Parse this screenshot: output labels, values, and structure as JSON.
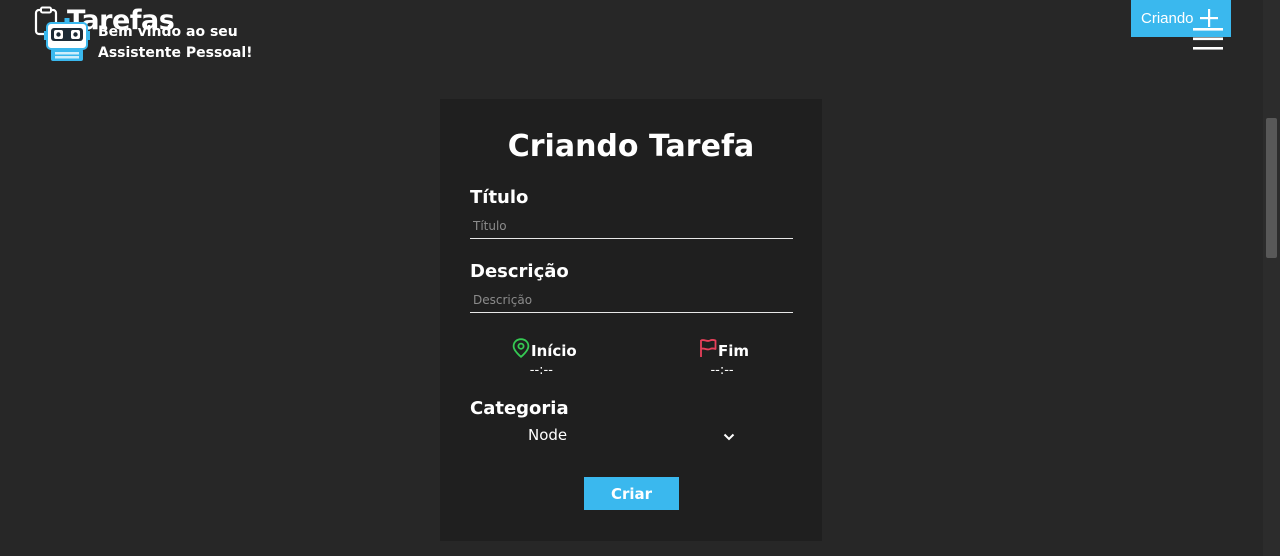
{
  "header": {
    "title": "Tarefas",
    "welcome_line1": "Bem vindo ao seu",
    "welcome_line2": "Assistente Pessoal!",
    "status_label": "Criando"
  },
  "form": {
    "title": "Criando Tarefa",
    "titulo": {
      "label": "Título",
      "placeholder": "Título",
      "value": ""
    },
    "descricao": {
      "label": "Descrição",
      "placeholder": "Descrição",
      "value": ""
    },
    "inicio": {
      "label": "Início",
      "value": "--:--",
      "icon": "map-pin-icon",
      "color": "#35c953"
    },
    "fim": {
      "label": "Fim",
      "value": "--:--",
      "icon": "flag-icon",
      "color": "#e8405a"
    },
    "categoria": {
      "label": "Categoria",
      "selected": "Node"
    },
    "submit_label": "Criar"
  },
  "colors": {
    "background": "#272727",
    "card": "#1f1f1f",
    "accent": "#3ab8ee"
  }
}
